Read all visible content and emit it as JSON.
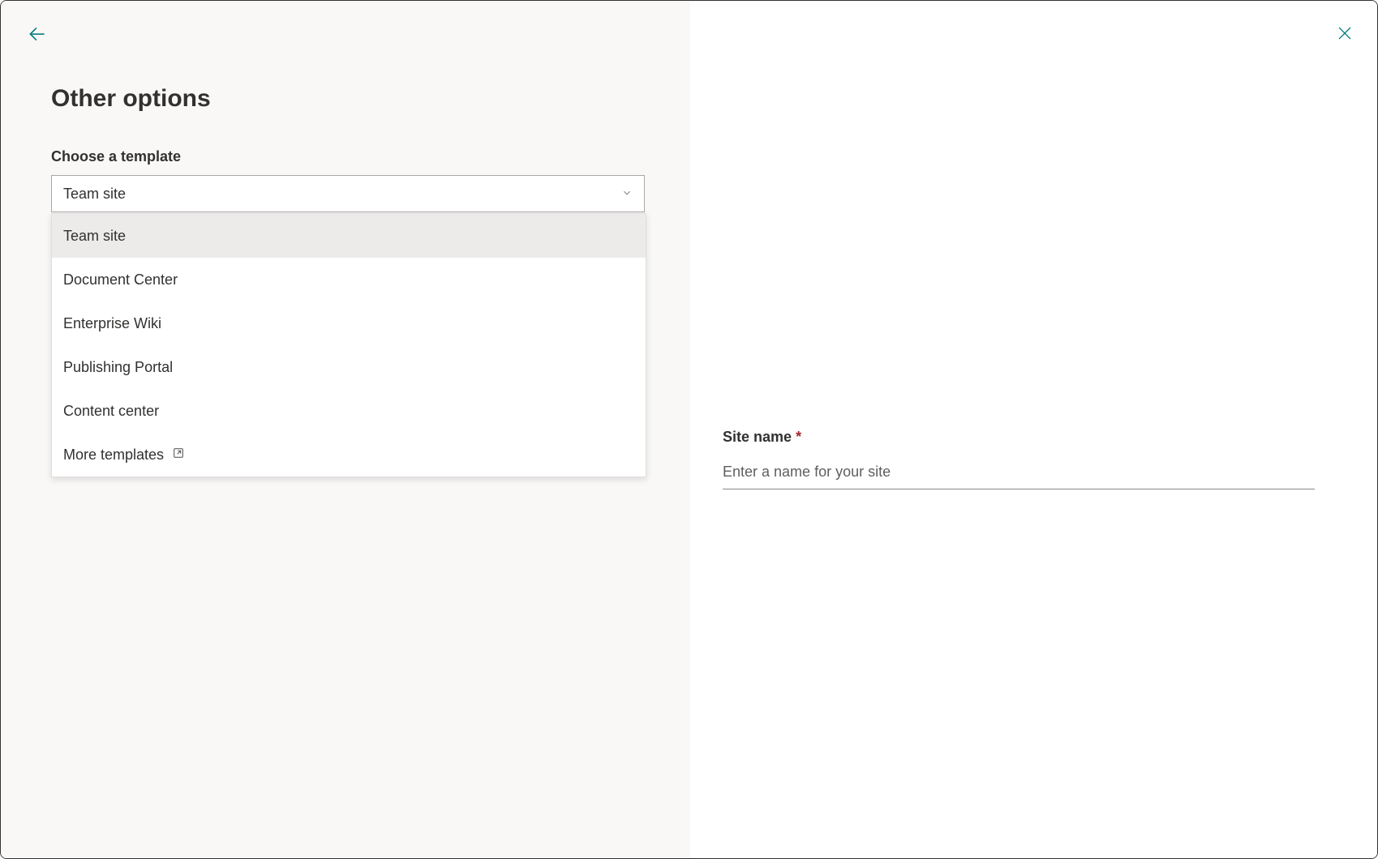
{
  "header": {
    "title": "Other options"
  },
  "template_selector": {
    "label": "Choose a template",
    "selected": "Team site",
    "options": {
      "team_site": "Team site",
      "document_center": "Document Center",
      "enterprise_wiki": "Enterprise Wiki",
      "publishing_portal": "Publishing Portal",
      "content_center": "Content center",
      "more_templates": "More templates"
    }
  },
  "site_name": {
    "label": "Site name",
    "required_indicator": "*",
    "placeholder": "Enter a name for your site"
  }
}
